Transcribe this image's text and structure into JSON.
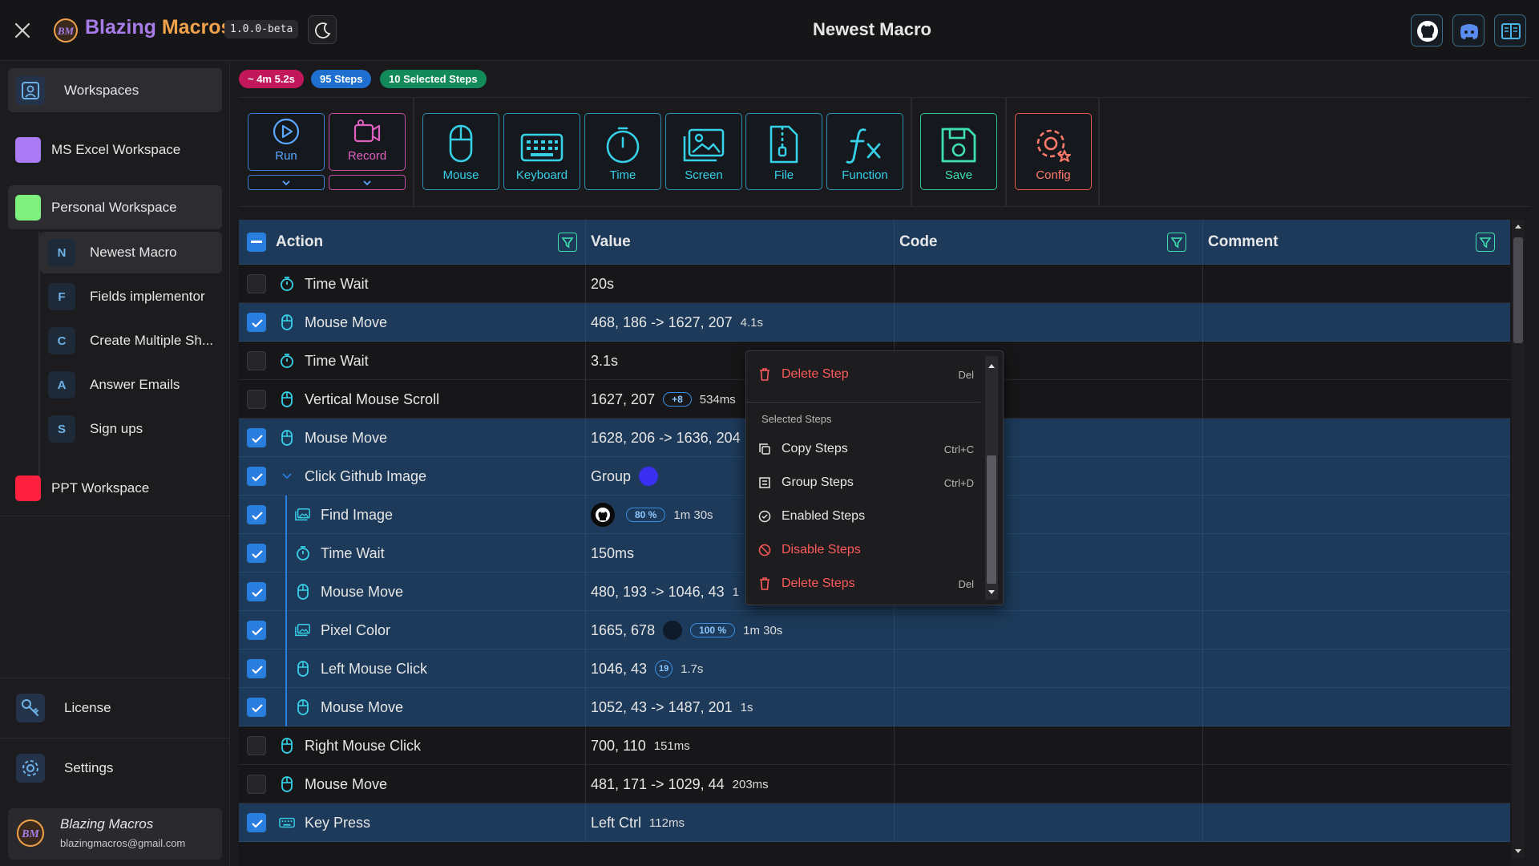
{
  "header": {
    "brand_main": "Blazing",
    "brand_accent": "Macros",
    "logo_text": "BM",
    "version": "1.0.0-beta",
    "title": "Newest Macro"
  },
  "sidebar": {
    "workspaces_label": "Workspaces",
    "workspaces": [
      {
        "name": "MS Excel Workspace",
        "color": "#a97cf5"
      },
      {
        "name": "Personal Workspace",
        "color": "#7ef07e"
      },
      {
        "name": "PPT Workspace",
        "color": "#ff1f3f"
      }
    ],
    "macros": [
      {
        "letter": "N",
        "name": "Newest Macro"
      },
      {
        "letter": "F",
        "name": "Fields implementor"
      },
      {
        "letter": "C",
        "name": "Create Multiple Sh..."
      },
      {
        "letter": "A",
        "name": "Answer Emails"
      },
      {
        "letter": "S",
        "name": "Sign ups"
      }
    ],
    "license_label": "License",
    "settings_label": "Settings",
    "user": {
      "name": "Blazing Macros",
      "email": "blazingmacros@gmail.com"
    }
  },
  "badges": {
    "duration": "~ 4m 5.2s",
    "steps": "95 Steps",
    "selected": "10 Selected Steps",
    "colors": {
      "duration": "#c2185b",
      "steps": "#1e6fd0",
      "selected": "#138a5a"
    }
  },
  "toolbar": {
    "run": "Run",
    "record": "Record",
    "mouse": "Mouse",
    "keyboard": "Keyboard",
    "time": "Time",
    "screen": "Screen",
    "file": "File",
    "function": "Function",
    "save": "Save",
    "config": "Config"
  },
  "table": {
    "headers": {
      "action": "Action",
      "value": "Value",
      "code": "Code",
      "comment": "Comment"
    },
    "rows": [
      {
        "checked": false,
        "icon": "timer",
        "action": "Time Wait",
        "value": "20s",
        "sub": "",
        "nested": false
      },
      {
        "checked": true,
        "icon": "mouse",
        "action": "Mouse Move",
        "value": "468, 186 -> 1627, 207",
        "sub": "4.1s",
        "nested": false
      },
      {
        "checked": false,
        "icon": "timer",
        "action": "Time Wait",
        "value": "3.1s",
        "sub": "",
        "nested": false
      },
      {
        "checked": false,
        "icon": "mouse",
        "action": "Vertical Mouse Scroll",
        "value": "1627, 207",
        "pill": "+8",
        "sub": "534ms",
        "nested": false
      },
      {
        "checked": true,
        "icon": "mouse",
        "action": "Mouse Move",
        "value": "1628, 206 -> 1636, 204",
        "sub": "",
        "nested": false
      },
      {
        "checked": true,
        "icon": "chevron",
        "action": "Click Github Image",
        "value": "Group",
        "sub": "",
        "nested": false,
        "dot": "#3a2ff0"
      },
      {
        "checked": true,
        "icon": "image",
        "action": "Find Image",
        "value": "",
        "pill": "80 %",
        "sub": "1m 30s",
        "nested": true,
        "github": true
      },
      {
        "checked": true,
        "icon": "timer",
        "action": "Time Wait",
        "value": "150ms",
        "sub": "",
        "nested": true
      },
      {
        "checked": true,
        "icon": "mouse",
        "action": "Mouse Move",
        "value": "480, 193 -> 1046, 43",
        "sub": "1",
        "nested": true
      },
      {
        "checked": true,
        "icon": "image",
        "action": "Pixel Color",
        "value": "1665, 678",
        "pill": "100 %",
        "sub": "1m 30s",
        "nested": true,
        "dot": "#0f1a2a"
      },
      {
        "checked": true,
        "icon": "mouse",
        "action": "Left Mouse Click",
        "value": "1046, 43",
        "circ": "19",
        "sub": "1.7s",
        "nested": true
      },
      {
        "checked": true,
        "icon": "mouse",
        "action": "Mouse Move",
        "value": "1052, 43 -> 1487, 201",
        "sub": "1s",
        "nested": true
      },
      {
        "checked": false,
        "icon": "mouse",
        "action": "Right Mouse Click",
        "value": "700, 110",
        "sub": "151ms",
        "nested": false
      },
      {
        "checked": false,
        "icon": "mouse",
        "action": "Mouse Move",
        "value": "481, 171 -> 1029, 44",
        "sub": "203ms",
        "nested": false
      },
      {
        "checked": true,
        "icon": "keyboard",
        "action": "Key Press",
        "value": "Left Ctrl",
        "sub": "112ms",
        "nested": false
      }
    ]
  },
  "context_menu": {
    "delete_step": "Delete Step",
    "delete_step_shortcut": "Del",
    "section_label": "Selected Steps",
    "copy": "Copy Steps",
    "copy_shortcut": "Ctrl+C",
    "group": "Group Steps",
    "group_shortcut": "Ctrl+D",
    "enable": "Enabled Steps",
    "disable": "Disable Steps",
    "delete_steps": "Delete Steps",
    "delete_steps_shortcut": "Del"
  }
}
